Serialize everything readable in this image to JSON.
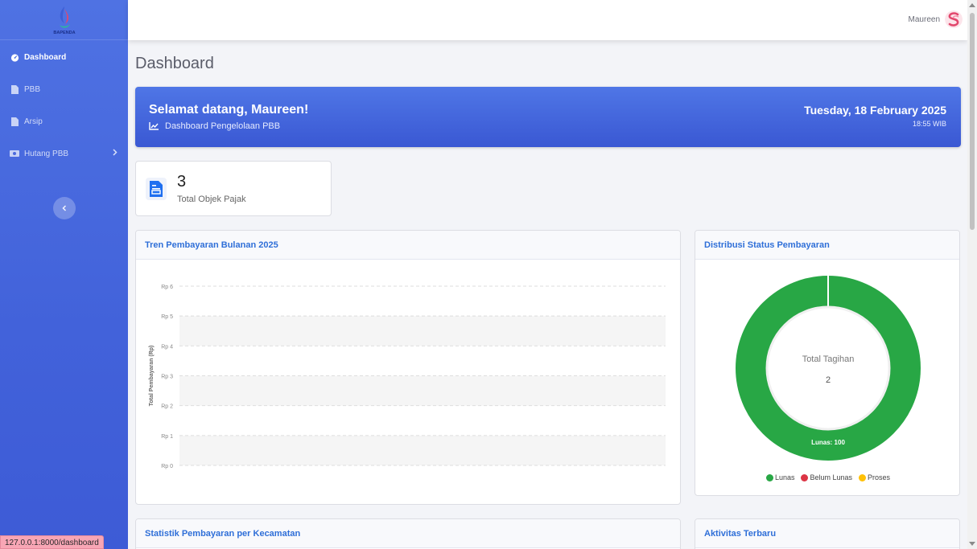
{
  "sidebar": {
    "brand_text": "BAPENDA",
    "items": [
      {
        "label": "Dashboard",
        "icon": "tachometer-icon"
      },
      {
        "label": "PBB",
        "icon": "file-icon"
      },
      {
        "label": "Arsip",
        "icon": "file-icon"
      },
      {
        "label": "Hutang PBB",
        "icon": "money-icon"
      }
    ]
  },
  "topbar": {
    "user_name": "Maureen"
  },
  "page": {
    "title": "Dashboard"
  },
  "welcome": {
    "greeting": "Selamat datang, Maureen!",
    "subtitle": "Dashboard Pengelolaan PBB",
    "date": "Tuesday, 18 February 2025",
    "time": "18:55 WIB"
  },
  "stat": {
    "value": "3",
    "label": "Total Objek Pajak"
  },
  "trend_card": {
    "title": "Tren Pembayaran Bulanan 2025"
  },
  "distribution_card": {
    "title": "Distribusi Status Pembayaran",
    "center_label": "Total Tagihan",
    "center_value": "2"
  },
  "kecamatan_card": {
    "title": "Statistik Pembayaran per Kecamatan"
  },
  "activity_card": {
    "title": "Aktivitas Terbaru"
  },
  "status_bar": {
    "url": "127.0.0.1:8000/dashboard"
  },
  "colors": {
    "sidebar": "#4262da",
    "accent": "#2f6fd8",
    "lunas": "#28a745",
    "belum_lunas": "#dc3545",
    "proses": "#ffc107"
  },
  "chart_data": [
    {
      "type": "line",
      "title": "",
      "xlabel": "",
      "ylabel": "Total Pembayaran (Rp)",
      "y_ticks": [
        "Rp 0",
        "Rp 1",
        "Rp 2",
        "Rp 3",
        "Rp 4",
        "Rp 5",
        "Rp 6"
      ],
      "ylim": [
        0,
        6
      ],
      "grid": true,
      "series": []
    },
    {
      "type": "pie",
      "title": "",
      "categories": [
        "Lunas",
        "Belum Lunas",
        "Proses"
      ],
      "values": [
        100,
        0,
        0
      ],
      "colors": [
        "#28a745",
        "#dc3545",
        "#ffc107"
      ],
      "slice_label": "Lunas: 100",
      "legend": "bottom"
    }
  ]
}
